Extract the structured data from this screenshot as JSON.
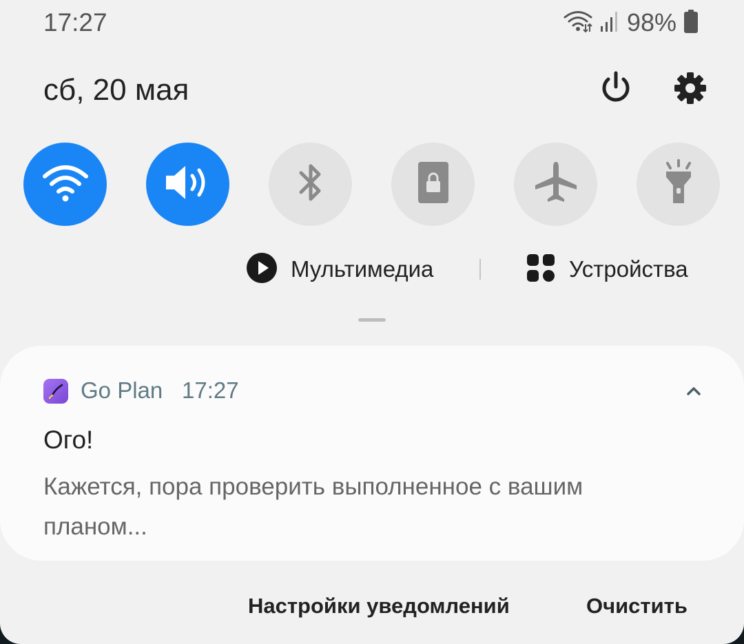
{
  "status_bar": {
    "time": "17:27",
    "battery": "98%",
    "icons": [
      "wifi-data-icon",
      "cellular-signal-icon",
      "battery-icon"
    ]
  },
  "header": {
    "date": "сб, 20 мая",
    "icons": [
      "power-icon",
      "gear-icon"
    ]
  },
  "quick_toggles": [
    {
      "name": "wifi",
      "icon": "wifi-icon",
      "state": "on"
    },
    {
      "name": "sound",
      "icon": "speaker-icon",
      "state": "on"
    },
    {
      "name": "bluetooth",
      "icon": "bluetooth-icon",
      "state": "off"
    },
    {
      "name": "rotation-lock",
      "icon": "portrait-lock-icon",
      "state": "off"
    },
    {
      "name": "airplane-mode",
      "icon": "airplane-icon",
      "state": "off"
    },
    {
      "name": "flashlight",
      "icon": "flashlight-icon",
      "state": "off"
    }
  ],
  "media_bar": {
    "media_label": "Мультимедиа",
    "devices_label": "Устройства"
  },
  "notification": {
    "app_name": "Go Plan",
    "time": "17:27",
    "title": "Ого!",
    "body": "Кажется, пора проверить выполненное с вашим планом..."
  },
  "footer": {
    "settings_label": "Настройки уведомлений",
    "clear_label": "Очистить"
  },
  "colors": {
    "panel_bg": "#f1f1f1",
    "toggle_on": "#1a86f5",
    "toggle_off": "#e3e3e3",
    "app_accent": "#8a55e0",
    "app_name_color": "#607a86"
  }
}
